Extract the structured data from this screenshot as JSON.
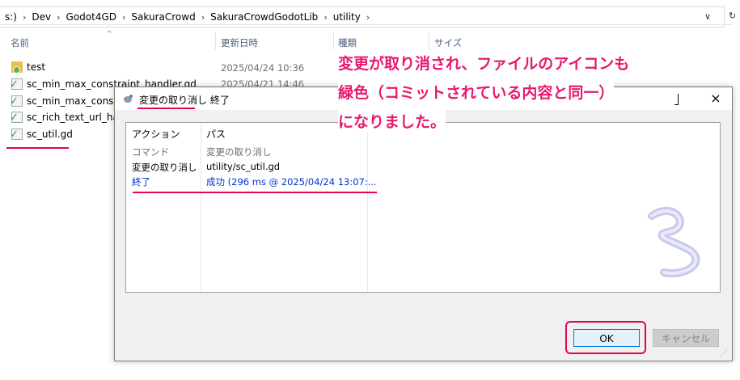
{
  "address_bar": {
    "crumbs": [
      "s:)",
      "Dev",
      "Godot4GD",
      "SakuraCrowd",
      "SakuraCrowdGodotLib",
      "utility"
    ],
    "separator": "›",
    "dropdown": "∨",
    "right_fragment": "↻"
  },
  "explorer": {
    "columns": {
      "name": "名前",
      "date": "更新日時",
      "type": "種類",
      "size": "サイズ"
    },
    "sort_caret": "^",
    "files": [
      {
        "name": "test",
        "date": "2025/04/24 10:36",
        "icon": "folder-green-check-icon"
      },
      {
        "name": "sc_min_max_constraint_handler.gd",
        "date": "2025/04/21 14:46",
        "icon": "gd-file-green-check-icon"
      },
      {
        "name": "sc_min_max_constrai",
        "date": "",
        "icon": "gd-file-green-check-icon"
      },
      {
        "name": "sc_rich_text_url_hand",
        "date": "",
        "icon": "gd-file-green-check-icon"
      },
      {
        "name": "sc_util.gd",
        "date": "",
        "icon": "gd-file-green-check-icon"
      }
    ]
  },
  "annotation": {
    "lines": [
      "変更が取り消され、ファイルのアイコンも",
      "緑色（コミットされている内容と同一）",
      "になりました。"
    ],
    "color": "#e8186f"
  },
  "dialog": {
    "title": "変更の取り消し 終了",
    "close": "×",
    "list_headers": {
      "action": "アクション",
      "path": "パス"
    },
    "rows": [
      {
        "action": "コマンド",
        "path": "変更の取り消し",
        "style": "gray"
      },
      {
        "action": "変更の取り消し",
        "path": "utility/sc_util.gd",
        "style": "normal"
      },
      {
        "action": "終了",
        "path": "成功 (296 ms @ 2025/04/24 13:07:...",
        "style": "blue"
      }
    ],
    "buttons": {
      "ok": "OK",
      "cancel": "キャンセル"
    },
    "grip": "⋰"
  },
  "colors": {
    "highlight": "#e6005a",
    "success_text": "#0033cc",
    "ok_border": "#0078d7"
  }
}
